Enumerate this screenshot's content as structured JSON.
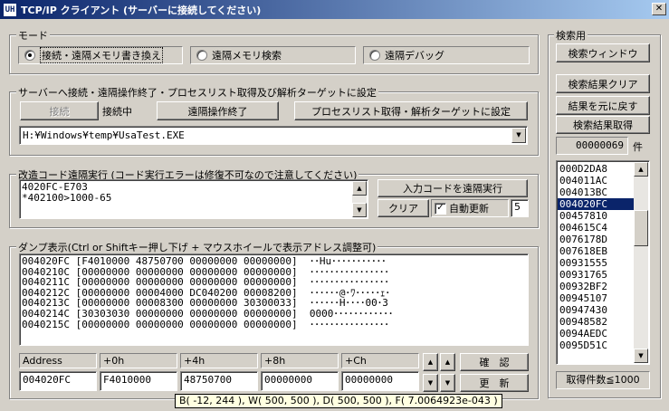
{
  "window": {
    "icon_text": "UH",
    "title": "TCP/IP クライアント (サーバーに接続してください)",
    "close_glyph": "✕"
  },
  "mode": {
    "label": "モード",
    "options": [
      {
        "label": "接続・遠隔メモリ書き換え",
        "selected": true
      },
      {
        "label": "遠隔メモリ検索",
        "selected": false
      },
      {
        "label": "遠隔デバッグ",
        "selected": false
      }
    ]
  },
  "connection": {
    "label": "サーバーへ接続・遠隔操作終了・プロセスリスト取得及び解析ターゲットに設定",
    "connect_button": "接続",
    "status": "接続中",
    "end_remote_button": "遠隔操作終了",
    "process_list_button": "プロセスリスト取得・解析ターゲットに設定",
    "target_path": "H:¥Windows¥temp¥UsaTest.EXE"
  },
  "code_exec": {
    "label": "改造コード遠隔実行 (コード実行エラーは修復不可なので注意してください)",
    "code_lines": [
      "4020FC-E703",
      "*402100>1000-65"
    ],
    "run_button": "入力コードを遠隔実行",
    "clear_button": "クリア",
    "auto_update_label": "自動更新",
    "auto_update_checked": true,
    "auto_update_interval": "5"
  },
  "dump": {
    "label": "ダンプ表示(Ctrl or Shiftキー押し下げ + マウスホイールで表示アドレス調整可)",
    "lines": [
      "004020FC [F4010000 48750700 00000000 00000000]  ･･Hu･･･････････",
      "0040210C [00000000 00000000 00000000 00000000]  ････････････････",
      "0040211C [00000000 00000000 00000000 00000000]  ････････････････",
      "0040212C [00000000 00004000 DC040200 00008200]  ･･････@･ﾜ･････ｪ･",
      "0040213C [00000000 00008300 00000000 30300033]  ･･････H････00･3",
      "0040214C [30303030 00000000 00000000 00000000]  0000････････････",
      "0040215C [00000000 00000000 00000000 00000000]  ････････････････"
    ],
    "fields": [
      {
        "label": "Address",
        "value": "004020FC"
      },
      {
        "label": "+0h",
        "value": "F4010000"
      },
      {
        "label": "+4h",
        "value": "48750700"
      },
      {
        "label": "+8h",
        "value": "00000000"
      },
      {
        "label": "+Ch",
        "value": "00000000"
      }
    ],
    "confirm_button": "確　認",
    "update_button": "更　新"
  },
  "search": {
    "label": "検索用",
    "window_button": "検索ウィンドウ",
    "clear_button": "検索結果クリア",
    "restore_button": "結果を元に戻す",
    "fetch_button": "検索結果取得",
    "count_value": "00000069",
    "count_unit": "件",
    "results": [
      "000D2DA8",
      "004011AC",
      "004013BC",
      "004020FC",
      "00457810",
      "004615C4",
      "0076178D",
      "007618EB",
      "00931555",
      "00931765",
      "00932BF2",
      "00945107",
      "00947430",
      "00948582",
      "0094AEDC",
      "0095D51C"
    ],
    "selected_index": 3,
    "limit_label": "取得件数≦1000"
  },
  "status_tooltip": "B( -12, 244 ), W( 500, 500 ), D( 500, 500 ), F( 7.0064923e-043 )",
  "colors": {
    "face": "#d4d0c8",
    "title_start": "#0a246a",
    "title_end": "#a6caf0",
    "selection": "#0a246a",
    "tooltip": "#ffffe1"
  }
}
